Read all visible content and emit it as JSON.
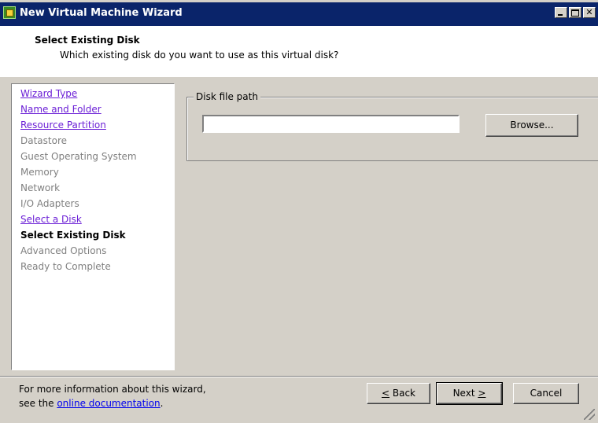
{
  "window": {
    "title": "New Virtual Machine Wizard"
  },
  "header": {
    "title": "Select Existing Disk",
    "subtitle": "Which existing disk do you want to use as this virtual disk?"
  },
  "nav": {
    "items": [
      {
        "label": "Wizard Type",
        "state": "link"
      },
      {
        "label": "Name and Folder",
        "state": "link"
      },
      {
        "label": "Resource Partition",
        "state": "link"
      },
      {
        "label": "Datastore",
        "state": "disabled"
      },
      {
        "label": "Guest Operating System",
        "state": "disabled"
      },
      {
        "label": "Memory",
        "state": "disabled"
      },
      {
        "label": "Network",
        "state": "disabled"
      },
      {
        "label": "I/O Adapters",
        "state": "disabled"
      },
      {
        "label": "Select a Disk",
        "state": "link"
      },
      {
        "label": "Select Existing Disk",
        "state": "current"
      },
      {
        "label": "Advanced Options",
        "state": "disabled"
      },
      {
        "label": "Ready to Complete",
        "state": "disabled"
      }
    ]
  },
  "disk": {
    "group_label": "Disk file path",
    "path_value": "",
    "browse_label": "Browse..."
  },
  "footer": {
    "info_line1": "For more information about this wizard,",
    "info_line2_prefix": "see the ",
    "doc_link": "online documentation",
    "info_line2_suffix": "."
  },
  "buttons": {
    "back_mnemonic": "<",
    "back_rest": " Back",
    "next_main": "Next ",
    "next_mnemonic": ">",
    "cancel": "Cancel"
  },
  "colors": {
    "titlebar": "#0a246a",
    "face": "#d4d0c8",
    "visited_link": "#6b1fd6",
    "disabled_text": "#808080"
  }
}
